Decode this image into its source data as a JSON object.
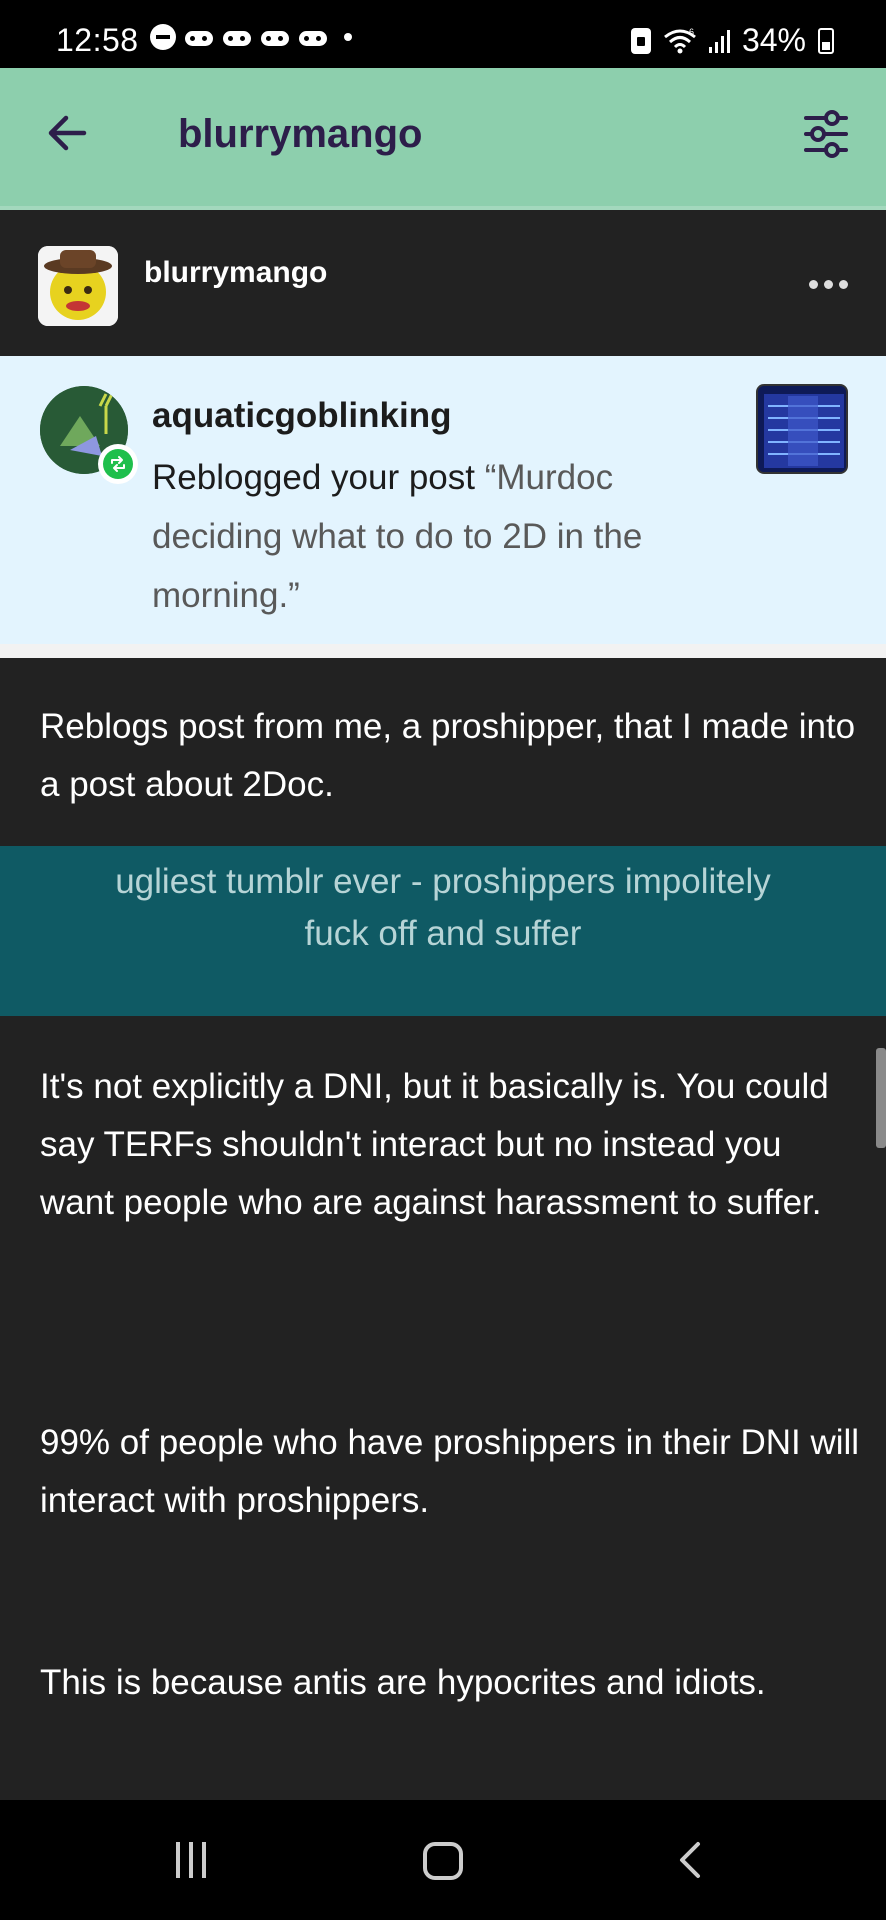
{
  "status_bar": {
    "time": "12:58",
    "battery": "34%",
    "icons": [
      "do-not-disturb-icon",
      "game-controller-icon",
      "game-controller-icon",
      "game-controller-icon",
      "game-controller-icon",
      "dot-icon",
      "lock-icon",
      "wifi-icon",
      "signal-icon",
      "battery-charging-icon"
    ]
  },
  "header": {
    "title": "blurrymango",
    "bg_color": "#8dcfad",
    "title_color": "#2d1e4a"
  },
  "post": {
    "blog_name": "blurrymango",
    "notification": {
      "username": "aquaticgoblinking",
      "text_prefix": "Reblogged your post ",
      "text_quote": "“Murdoc deciding what to do to 2D in the morning.”",
      "bg_color": "#e3f4fe"
    },
    "paragraph_1": "Reblogs post from me, a proshipper, that I made into a post about 2Doc.",
    "quoted_block": {
      "line_1": "ugliest tumblr ever - proshippers impolitely",
      "line_2": "fuck off and suffer",
      "bg_color": "#0f5a64"
    },
    "paragraph_2": "It's not explicitly a DNI, but it basically is. You could say TERFs shouldn't interact but no instead you want people who are against harassment to suffer.",
    "paragraph_3": "99% of people who have proshippers in their DNI will interact with proshippers.",
    "paragraph_4": "This is because antis are hypocrites and idiots."
  },
  "nav_bar": {
    "buttons": [
      "recent-apps-icon",
      "home-icon",
      "back-icon"
    ]
  }
}
